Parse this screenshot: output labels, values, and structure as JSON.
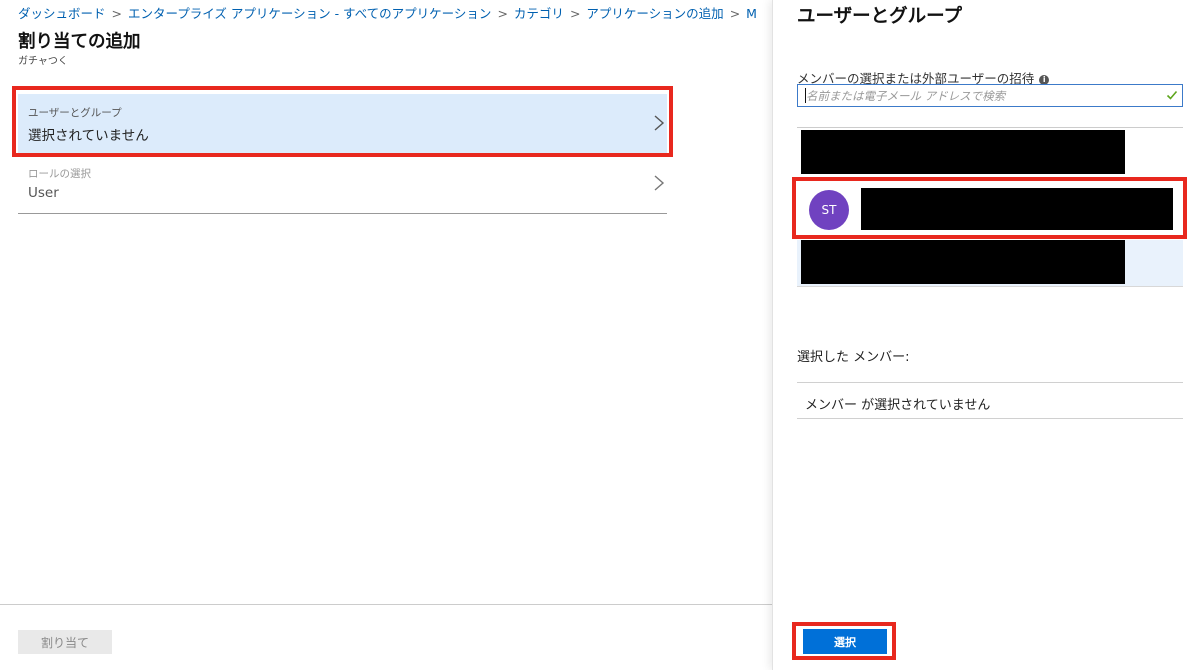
{
  "breadcrumb": [
    "ダッシュボード",
    "エンタープライズ アプリケーション - すべてのアプリケーション",
    "カテゴリ",
    "アプリケーションの追加",
    "M"
  ],
  "page": {
    "title": "割り当ての追加",
    "subtitle": "ガチャつく"
  },
  "form": {
    "users_groups": {
      "label": "ユーザーとグループ",
      "value": "選択されていません"
    },
    "role": {
      "label": "ロールの選択",
      "value": "User"
    }
  },
  "assign_button": "割り当て",
  "panel": {
    "title": "ユーザーとグループ",
    "search_label": "メンバーの選択または外部ユーザーの招待",
    "search_placeholder": "名前または電子メール アドレスで検索",
    "results": [
      {
        "avatar_initials": ""
      },
      {
        "avatar_initials": "ST",
        "avatar_color": "#7042c0"
      },
      {
        "avatar_initials": ""
      }
    ],
    "selected_label": "選択した メンバー:",
    "selected_empty": "メンバー が選択されていません",
    "select_button": "選択"
  },
  "colors": {
    "accent": "#0070d8",
    "highlight": "#e8281e",
    "selected_field_bg": "#dcebfb"
  }
}
